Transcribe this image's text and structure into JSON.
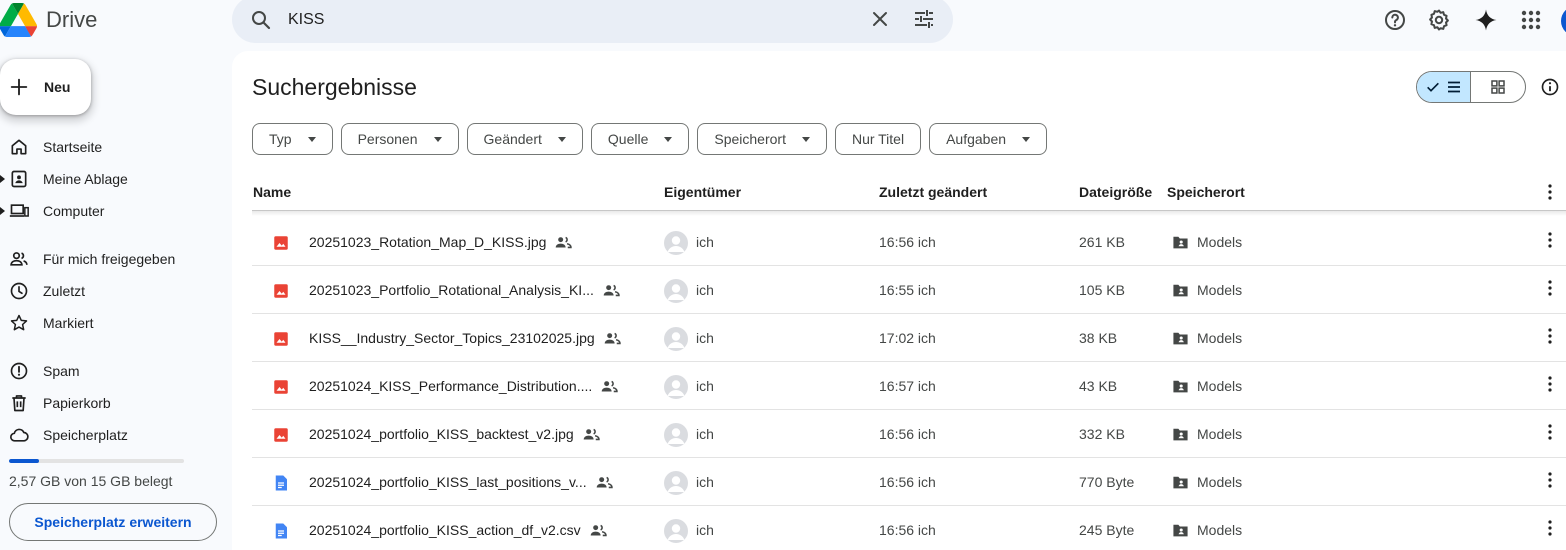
{
  "app": {
    "name": "Drive"
  },
  "search": {
    "query": "KISS"
  },
  "sidebar": {
    "new_label": "Neu",
    "items": [
      {
        "label": "Startseite"
      },
      {
        "label": "Meine Ablage"
      },
      {
        "label": "Computer"
      },
      {
        "label": "Für mich freigegeben"
      },
      {
        "label": "Zuletzt"
      },
      {
        "label": "Markiert"
      },
      {
        "label": "Spam"
      },
      {
        "label": "Papierkorb"
      },
      {
        "label": "Speicherplatz"
      }
    ],
    "storage": {
      "text": "2,57 GB von 15 GB belegt",
      "used_fraction": 0.171,
      "button": "Speicherplatz erweitern"
    }
  },
  "main": {
    "title": "Suchergebnisse",
    "filters": [
      {
        "label": "Typ",
        "dropdown": true
      },
      {
        "label": "Personen",
        "dropdown": true
      },
      {
        "label": "Geändert",
        "dropdown": true
      },
      {
        "label": "Quelle",
        "dropdown": true
      },
      {
        "label": "Speicherort",
        "dropdown": true
      },
      {
        "label": "Nur Titel",
        "dropdown": false
      },
      {
        "label": "Aufgaben",
        "dropdown": true
      }
    ],
    "columns": {
      "name": "Name",
      "owner": "Eigentümer",
      "modified": "Zuletzt geändert",
      "size": "Dateigröße",
      "location": "Speicherort"
    },
    "files": [
      {
        "name": "20251023_Rotation_Map_D_KISS.jpg",
        "type": "image",
        "owner": "ich",
        "modified": "16:56 ich",
        "size": "261 KB",
        "location": "Models"
      },
      {
        "name": "20251023_Portfolio_Rotational_Analysis_KI...",
        "type": "image",
        "owner": "ich",
        "modified": "16:55 ich",
        "size": "105 KB",
        "location": "Models"
      },
      {
        "name": "KISS__Industry_Sector_Topics_23102025.jpg",
        "type": "image",
        "owner": "ich",
        "modified": "17:02 ich",
        "size": "38 KB",
        "location": "Models"
      },
      {
        "name": "20251024_KISS_Performance_Distribution....",
        "type": "image",
        "owner": "ich",
        "modified": "16:57 ich",
        "size": "43 KB",
        "location": "Models"
      },
      {
        "name": "20251024_portfolio_KISS_backtest_v2.jpg",
        "type": "image",
        "owner": "ich",
        "modified": "16:56 ich",
        "size": "332 KB",
        "location": "Models"
      },
      {
        "name": "20251024_portfolio_KISS_last_positions_v...",
        "type": "doc",
        "owner": "ich",
        "modified": "16:56 ich",
        "size": "770 Byte",
        "location": "Models"
      },
      {
        "name": "20251024_portfolio_KISS_action_df_v2.csv",
        "type": "doc",
        "owner": "ich",
        "modified": "16:56 ich",
        "size": "245 Byte",
        "location": "Models"
      }
    ]
  },
  "colors": {
    "accent": "#0b57d0",
    "image_icon": "#ea4335",
    "doc_icon": "#4285f4",
    "selected_view": "#c2e7ff",
    "search_bg": "#e9eef6"
  }
}
